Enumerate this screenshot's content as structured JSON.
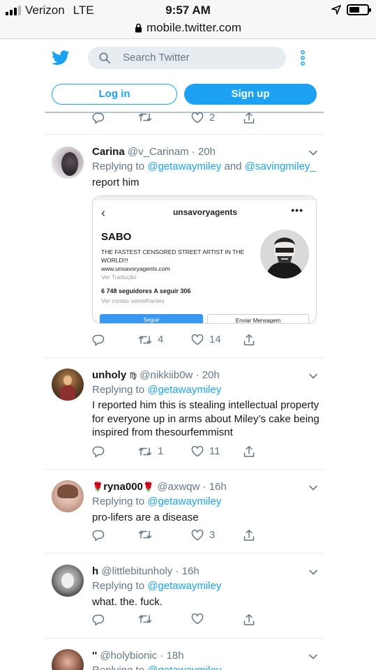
{
  "status_bar": {
    "carrier": "Verizon",
    "network": "LTE",
    "time": "9:57 AM"
  },
  "browser": {
    "url": "mobile.twitter.com"
  },
  "header": {
    "search_placeholder": "Search Twitter",
    "login_label": "Log in",
    "signup_label": "Sign up"
  },
  "top_actions": {
    "likes": "2"
  },
  "tweets": [
    {
      "name": "Carina",
      "handle": "@v_Carinam",
      "time": "20h",
      "replying_prefix": "Replying to",
      "replying_to": [
        "@getawaymiley",
        "@savingmiley_"
      ],
      "replying_joiner": "and",
      "text": "report him",
      "embed": {
        "username": "unsavoryagents",
        "display_name": "SABO",
        "bio": "THE FASTEST CENSORED STREET ARTIST IN THE WORLD!!!",
        "website": "www.unsavoryagents.com",
        "translate": "Ver Tradução",
        "stats": "6 748 seguidores  A seguir 306",
        "similar": "Ver contas semelhantes",
        "follow_label": "Seguir",
        "message_label": "Enviar Mensagem"
      },
      "retweets": "4",
      "likes": "14"
    },
    {
      "name": "unholy",
      "badge": "♍",
      "handle": "@nikkiib0w",
      "time": "20h",
      "replying_prefix": "Replying to",
      "replying_to": [
        "@getawaymiley"
      ],
      "text": "I reported him this is stealing intellectual property for everyone up in arms about Miley’s cake being inspired from thesourfemmisnt",
      "retweets": "1",
      "likes": "11"
    },
    {
      "name": "ryna000",
      "name_emoji": "🌹",
      "handle": "@axwqw",
      "time": "16h",
      "replying_prefix": "Replying to",
      "replying_to": [
        "@getawaymiley"
      ],
      "text": "pro-lifers are a disease",
      "retweets": "",
      "likes": "3"
    },
    {
      "name": "h",
      "handle": "@littlebitunholy",
      "time": "16h",
      "replying_prefix": "Replying to",
      "replying_to": [
        "@getawaymiley"
      ],
      "text": "what. the. fuck.",
      "retweets": "",
      "likes": ""
    },
    {
      "name": "''",
      "handle": "@holybionic",
      "time": "18h",
      "replying_prefix": "Replying to",
      "replying_to": [
        "@getawaymiley"
      ]
    }
  ],
  "colors": {
    "brand": "#1da1f2",
    "muted": "#657786",
    "divider": "#e6ecf0"
  }
}
